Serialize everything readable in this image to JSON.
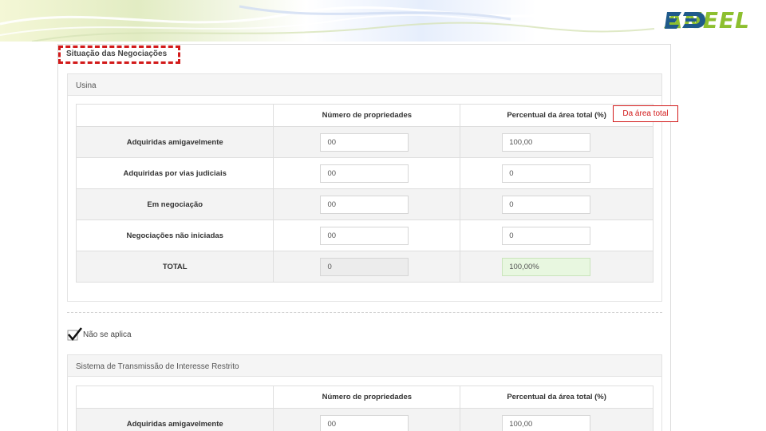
{
  "header": {
    "logo_text": "ANEEL",
    "accent": "#8dbf2f",
    "logo_mark_color": "#1f5a8a"
  },
  "section": {
    "title": "Situação das Negociações"
  },
  "callout": {
    "text": "Da área total",
    "color": "#d21a1a"
  },
  "usina": {
    "title": "Usina",
    "columns": [
      "Número de propriedades",
      "Percentual da área total (%)"
    ],
    "rows": [
      {
        "label": "Adquiridas amigavelmente",
        "count": "00",
        "percent": "100,00"
      },
      {
        "label": "Adquiridas por vias judiciais",
        "count": "00",
        "percent": "0"
      },
      {
        "label": "Em negociação",
        "count": "00",
        "percent": "0"
      },
      {
        "label": "Negociações não iniciadas",
        "count": "00",
        "percent": "0"
      },
      {
        "label": "TOTAL",
        "count": "0",
        "percent": "100,00%"
      }
    ]
  },
  "not_applicable": {
    "label": "Não se aplica",
    "checked": true
  },
  "transmissao": {
    "title": "Sistema de Transmissão de Interesse Restrito",
    "columns": [
      "Número de propriedades",
      "Percentual da área total (%)"
    ],
    "rows": [
      {
        "label": "Adquiridas amigavelmente",
        "count": "00",
        "percent": "100,00"
      }
    ]
  }
}
